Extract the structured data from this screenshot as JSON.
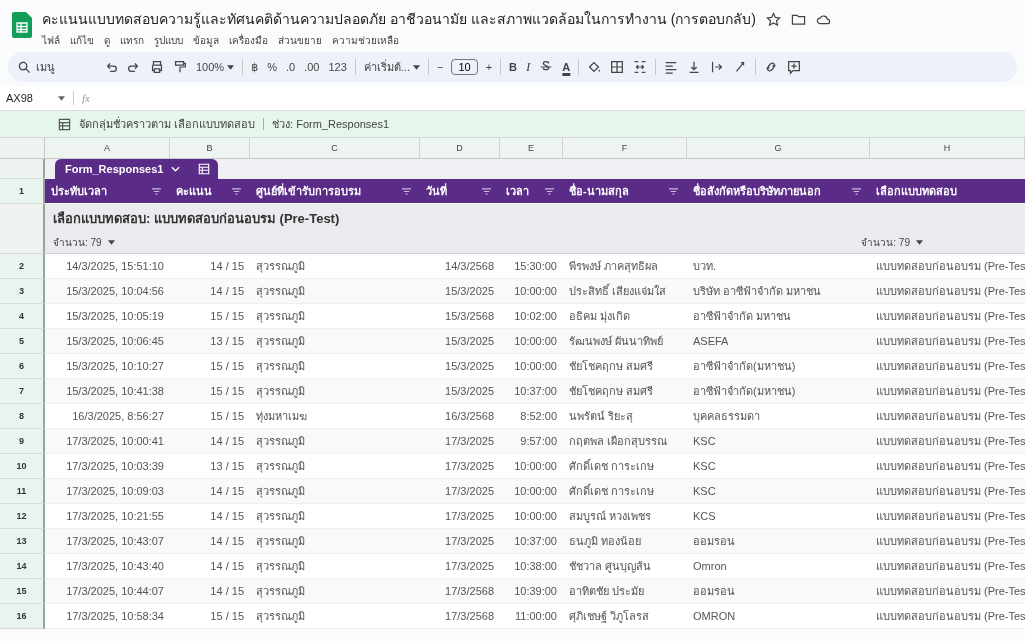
{
  "document": {
    "title": "คะแนนแบบทดสอบความรู้และทัศนคติด้านความปลอดภัย อาชีวอนามัย และสภาพแวดล้อมในการทำงาน (การตอบกลับ)"
  },
  "menu": [
    "ไฟล์",
    "แก้ไข",
    "ดู",
    "แทรก",
    "รูปแบบ",
    "ข้อมูล",
    "เครื่องมือ",
    "ส่วนขยาย",
    "ความช่วยเหลือ"
  ],
  "toolbar": [
    {
      "kind": "search",
      "text": "เมนู"
    },
    {
      "kind": "undo"
    },
    {
      "kind": "redo"
    },
    {
      "kind": "print"
    },
    {
      "kind": "paint"
    },
    {
      "kind": "dropdown",
      "text": "100%"
    },
    {
      "kind": "sep"
    },
    {
      "kind": "text",
      "text": "฿"
    },
    {
      "kind": "text",
      "text": "%"
    },
    {
      "kind": "text",
      "text": ".0"
    },
    {
      "kind": "text",
      "text": ".00"
    },
    {
      "kind": "text",
      "text": "123"
    },
    {
      "kind": "sep"
    },
    {
      "kind": "dropdown",
      "text": "ค่าเริ่มต้..."
    },
    {
      "kind": "sep"
    },
    {
      "kind": "text",
      "text": "−"
    },
    {
      "kind": "field",
      "text": "10"
    },
    {
      "kind": "text",
      "text": "+"
    },
    {
      "kind": "sep"
    },
    {
      "kind": "bold",
      "text": "B"
    },
    {
      "kind": "italic",
      "text": "I"
    },
    {
      "kind": "strike"
    },
    {
      "kind": "textcolor",
      "text": "A"
    },
    {
      "kind": "sep"
    },
    {
      "kind": "fill"
    },
    {
      "kind": "borders"
    },
    {
      "kind": "merge"
    },
    {
      "kind": "sep"
    },
    {
      "kind": "align"
    },
    {
      "kind": "valign"
    },
    {
      "kind": "wrap"
    },
    {
      "kind": "rotate"
    },
    {
      "kind": "sep"
    },
    {
      "kind": "link"
    },
    {
      "kind": "comment"
    }
  ],
  "formula_bar": {
    "cell": "AX98",
    "fx": "fx"
  },
  "group_bar": {
    "label": "จัดกลุ่มชั่วคราวตาม เลือกแบบทดสอบ",
    "range": "ช่วง: Form_Responses1"
  },
  "column_letters": [
    "A",
    "B",
    "C",
    "D",
    "E",
    "F",
    "G",
    "H"
  ],
  "table": {
    "name": "Form_Responses1",
    "header_row": "1",
    "columns": [
      "ประทับเวลา",
      "คะแนน",
      "ศูนย์ที่เข้ารับการอบรม",
      "วันที่",
      "เวลา",
      "ชื่อ-นามสกุล",
      "ชื่อสังกัดหรือบริษัทภายนอก",
      "เลือกแบบทดสอบ"
    ],
    "group": {
      "title": "เลือกแบบทดสอบ: แบบทดสอบก่อนอบรม (Pre-Test)",
      "count_first": "จำนวน: 79",
      "count_last": "จำนวน: 79"
    },
    "rows": [
      {
        "n": "2",
        "cells": [
          "14/3/2025, 15:51:10",
          "14 / 15",
          "สุวรรณภูมิ",
          "14/3/2568",
          "15:30:00",
          "พีรพงษ์ ภาคสุทธิผล",
          "บวท.",
          "แบบทดสอบก่อนอบรม (Pre-Tes"
        ]
      },
      {
        "n": "3",
        "cells": [
          "15/3/2025, 10:04:56",
          "14 / 15",
          "สุวรรณภูมิ",
          "15/3/2025",
          "10:00:00",
          "ประสิทธิ์ เสียงแจ่มใส",
          "บริษัท อาซีฟ้าจำกัด มหาชน",
          "แบบทดสอบก่อนอบรม (Pre-Tes"
        ]
      },
      {
        "n": "4",
        "cells": [
          "15/3/2025, 10:05:19",
          "15 / 15",
          "สุวรรณภูมิ",
          "15/3/2568",
          "10:02:00",
          "อธิคม มุ่งเกิด",
          "อาซีฟ้าจำกัด มหาชน",
          "แบบทดสอบก่อนอบรม (Pre-Tes"
        ]
      },
      {
        "n": "5",
        "cells": [
          "15/3/2025, 10:06:45",
          "13 / 15",
          "สุวรรณภูมิ",
          "15/3/2025",
          "10:00:00",
          "รัฒนพงษ์ ผันนาทิพย์",
          "ASEFA",
          "แบบทดสอบก่อนอบรม (Pre-Tes"
        ]
      },
      {
        "n": "6",
        "cells": [
          "15/3/2025, 10:10:27",
          "15 / 15",
          "สุวรรณภูมิ",
          "15/3/2025",
          "10:00:00",
          "ชัยโชคฤกษ  สมศรี",
          "อาซีฟ้าจำกัด(มหาชน)",
          "แบบทดสอบก่อนอบรม (Pre-Tes"
        ]
      },
      {
        "n": "7",
        "cells": [
          "15/3/2025, 10:41:38",
          "15 / 15",
          "สุวรรณภูมิ",
          "15/3/2025",
          "10:37:00",
          "ชัยโชคฤกษ สมศรี",
          "อาซีฟ้าจำกัด(มหาชน)",
          "แบบทดสอบก่อนอบรม (Pre-Tes"
        ]
      },
      {
        "n": "8",
        "cells": [
          "16/3/2025, 8:56:27",
          "15 / 15",
          "ทุ่งมหาเมฆ",
          "16/3/2568",
          "8:52:00",
          "นพรัตน์ ริยะสุ",
          "บุคคลธรรมดา",
          "แบบทดสอบก่อนอบรม (Pre-Tes"
        ]
      },
      {
        "n": "9",
        "cells": [
          "17/3/2025, 10:00:41",
          "14 / 15",
          "สุวรรณภูมิ",
          "17/3/2025",
          "9:57:00",
          "กฤตพล เผือกสุบรรณ",
          "KSC",
          "แบบทดสอบก่อนอบรม (Pre-Tes"
        ]
      },
      {
        "n": "10",
        "cells": [
          "17/3/2025, 10:03:39",
          "13 / 15",
          "สุวรรณภูมิ",
          "17/3/2025",
          "10:00:00",
          "ศักดิ์เดช การะเกษ",
          "KSC",
          "แบบทดสอบก่อนอบรม (Pre-Tes"
        ]
      },
      {
        "n": "11",
        "cells": [
          "17/3/2025, 10:09:03",
          "14 / 15",
          "สุวรรณภูมิ",
          "17/3/2025",
          "10:00:00",
          "ศักดิ์เดช การะเกษ",
          "KSC",
          "แบบทดสอบก่อนอบรม (Pre-Tes"
        ]
      },
      {
        "n": "12",
        "cells": [
          "17/3/2025, 10:21:55",
          "14 / 15",
          "สุวรรณภูมิ",
          "17/3/2025",
          "10:00:00",
          "สมบูรณ์ หวงเพชร",
          "KCS",
          "แบบทดสอบก่อนอบรม (Pre-Tes"
        ]
      },
      {
        "n": "13",
        "cells": [
          "17/3/2025, 10:43:07",
          "14 / 15",
          "สุวรรณภูมิ",
          "17/3/2025",
          "10:37:00",
          "ธนภูมิ ทองน้อย",
          "ออมรอน",
          "แบบทดสอบก่อนอบรม (Pre-Tes"
        ]
      },
      {
        "n": "14",
        "cells": [
          "17/3/2025, 10:43:40",
          "14 / 15",
          "สุวรรณภูมิ",
          "17/3/2025",
          "10:38:00",
          "ชัชวาล ศูนบุญส้น",
          "Omron",
          "แบบทดสอบก่อนอบรม (Pre-Tes"
        ]
      },
      {
        "n": "15",
        "cells": [
          "17/3/2025, 10:44:07",
          "14 / 15",
          "สุวรรณภูมิ",
          "17/3/2568",
          "10:39:00",
          "อาทิตชัย ประมัย",
          "ออมรอน",
          "แบบทดสอบก่อนอบรม (Pre-Tes"
        ]
      },
      {
        "n": "16",
        "cells": [
          "17/3/2025, 10:58:34",
          "15 / 15",
          "สุวรรณภูมิ",
          "17/3/2568",
          "11:00:00",
          "ศุภิเชษฐ์ วิภูโลรส",
          "OMRON",
          "แบบทดสอบก่อนอบรม (Pre-Tes"
        ]
      }
    ]
  }
}
